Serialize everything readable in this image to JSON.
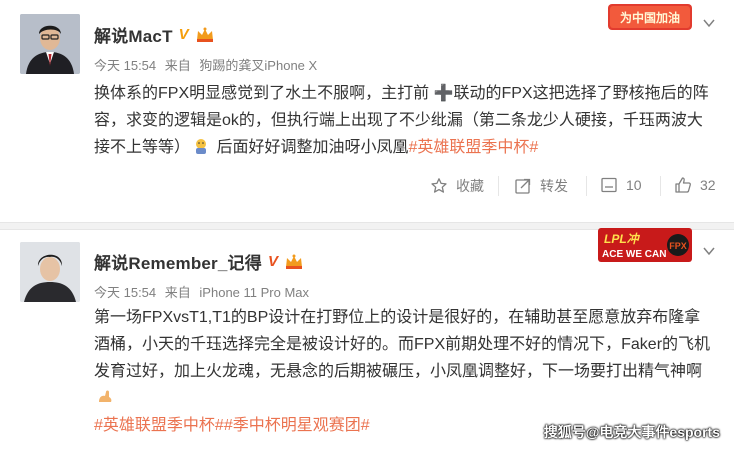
{
  "posts": [
    {
      "user_name": "解说MacT",
      "verified_mark": "V",
      "time": "今天 15:54",
      "source_prefix": "来自",
      "source": "狗踢的龚叉iPhone X",
      "content_text": "换体系的FPX明显感觉到了水土不服啊，主打前 ➕联动的FPX这把选择了野核拖后的阵容，求变的逻辑是ok的，但执行端上出现了不少纰漏（第二条龙少人硬接，千珏两波大接不上等等）",
      "content_tail": " 后面好好调整加油呀小凤凰",
      "hashtag": "#英雄联盟季中杯#",
      "toolbar": {
        "favorite_label": "收藏",
        "repost_label": "转发",
        "comment_count": "10",
        "like_count": "32"
      },
      "decoration_text": "为中国加油"
    },
    {
      "user_name": "解说Remember_记得",
      "verified_mark": "V",
      "time": "今天 15:54",
      "source_prefix": "来自",
      "source": "iPhone 11 Pro Max",
      "content_text": "第一场FPXvsT1,T1的BP设计在打野位上的设计是很好的，在辅助甚至愿意放弃布隆拿酒桶，小天的千珏选择完全是被设计好的。而FPX前期处理不好的情况下，Faker的飞机发育过好，加上火龙魂，无悬念的后期被碾压，小凤凰调整好，下一场要打出精气神啊",
      "hashtags": [
        "#英雄联盟季中杯#",
        "#季中杯明星观赛团#"
      ],
      "decoration_text_1": "LPL冲",
      "decoration_text_2": "ACE WE CAN",
      "decoration_text_3": "FPX"
    }
  ],
  "watermark": "搜狐号@电竞大事件esports",
  "colors": {
    "hashtag": "#eb7350",
    "meta": "#808080",
    "gold_v": "#f59e0b",
    "orange_v": "#e8521f"
  },
  "icons": {
    "favorite": "star-icon",
    "repost": "repost-icon",
    "comment": "comment-icon",
    "like": "thumbs-up-icon",
    "menu": "chevron-down-icon"
  }
}
